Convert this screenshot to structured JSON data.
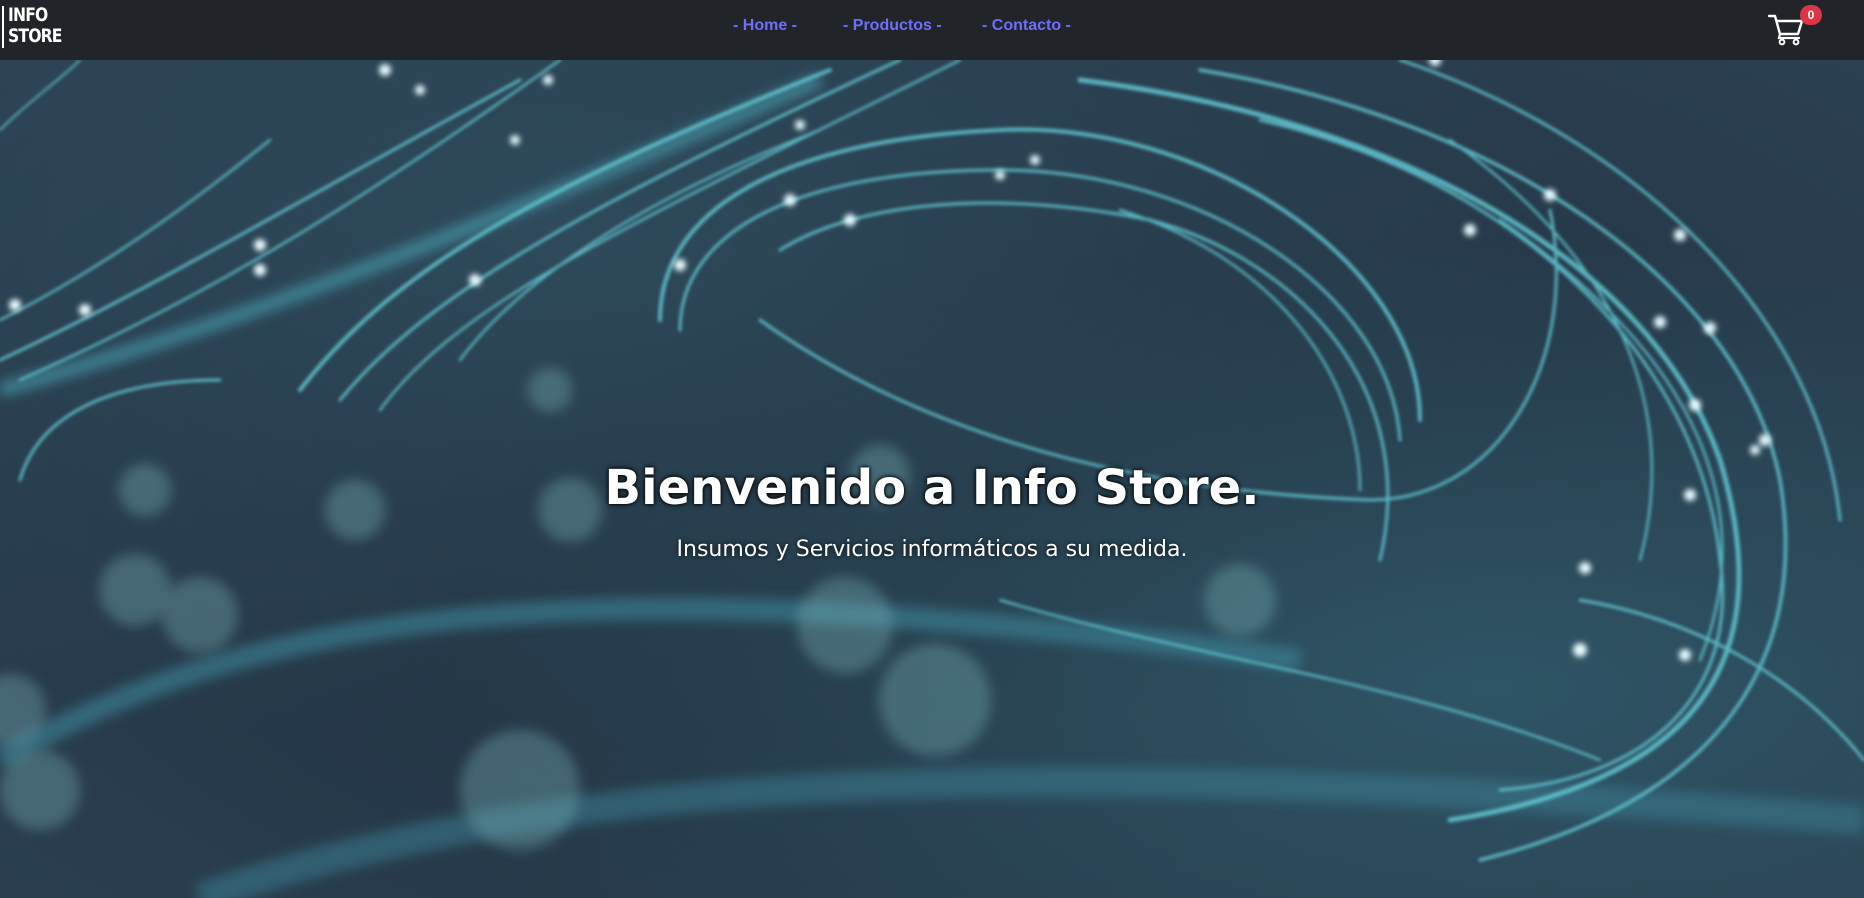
{
  "brand": {
    "logo_line1": "INFO",
    "logo_line2": "STORE"
  },
  "nav": {
    "items": [
      {
        "label": "- Home -"
      },
      {
        "label": "- Productos -"
      },
      {
        "label": "- Contacto -"
      }
    ]
  },
  "cart": {
    "icon": "cart-icon",
    "count": "0"
  },
  "hero": {
    "title": "Bienvenido a Info Store.",
    "subtitle": "Insumos y Servicios informáticos a su medida."
  },
  "colors": {
    "navbar_bg": "#212529",
    "nav_link": "#6f6ffb",
    "badge": "#dc3545",
    "hero_bg": "#243444"
  }
}
